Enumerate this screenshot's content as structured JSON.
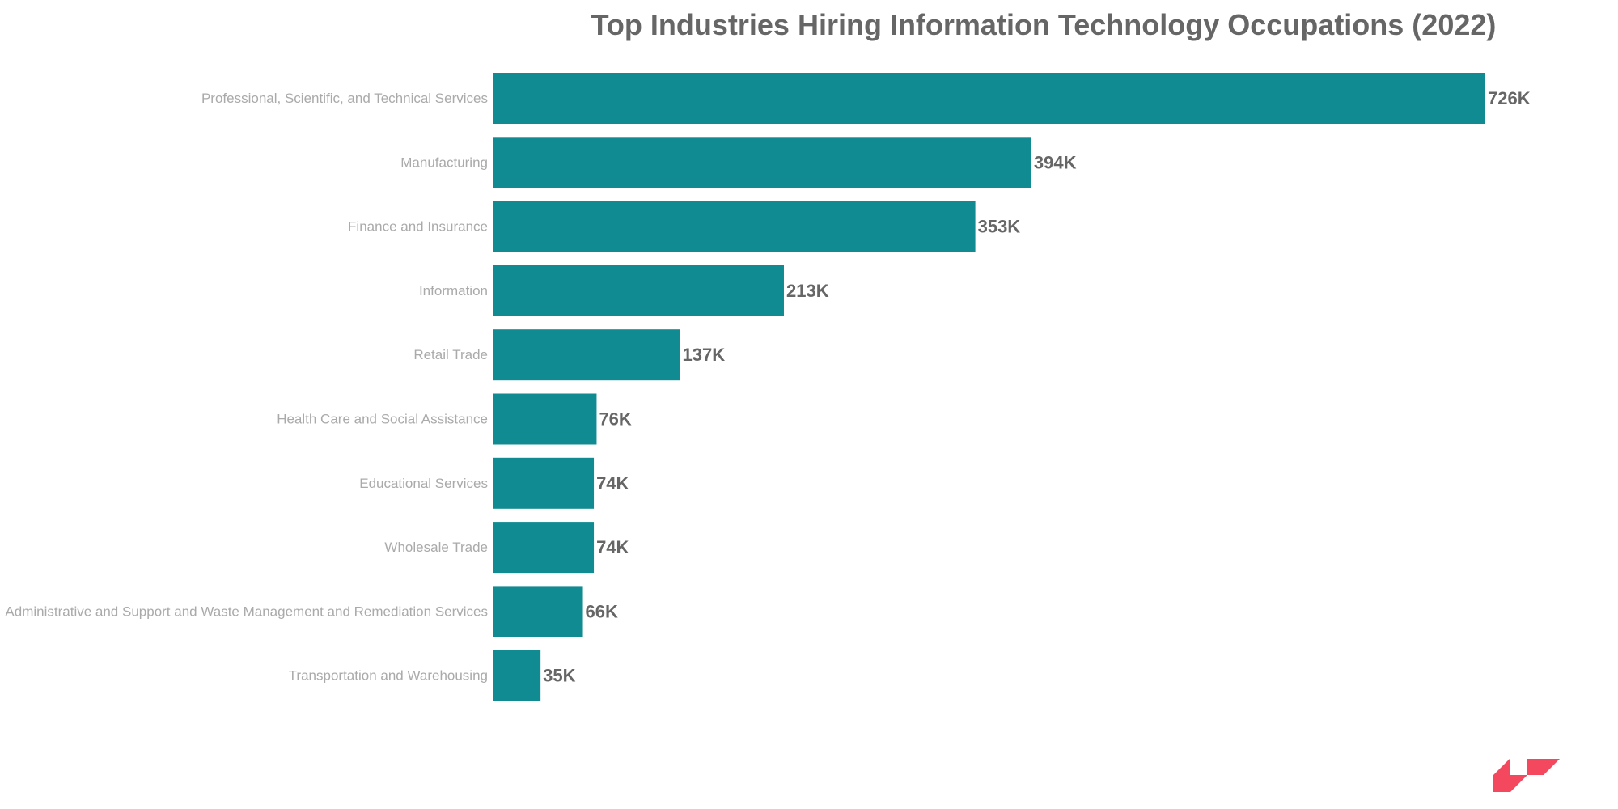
{
  "chart_data": {
    "type": "bar",
    "orientation": "horizontal",
    "title": "Top Industries Hiring Information Technology Occupations (2022)",
    "xlabel": "",
    "ylabel": "",
    "grid": false,
    "legend": "none",
    "value_unit": "thousands",
    "categories": [
      "Professional, Scientific, and Technical Services",
      "Manufacturing",
      "Finance and Insurance",
      "Information",
      "Retail Trade",
      "Health Care and Social Assistance",
      "Educational Services",
      "Wholesale Trade",
      "Administrative and Support and Waste Management and Remediation Services",
      "Transportation and Warehousing"
    ],
    "values": [
      726,
      394,
      353,
      213,
      137,
      76,
      74,
      74,
      66,
      35
    ],
    "data_labels": [
      "726K",
      "394K",
      "353K",
      "213K",
      "137K",
      "76K",
      "74K",
      "74K",
      "66K",
      "35K"
    ],
    "xlim": [
      0,
      726
    ]
  },
  "colors": {
    "bar": "#108b91",
    "logo": "#f4485f",
    "title": "#666666",
    "category_label": "#aaaaaa",
    "value_label": "#666666"
  },
  "logo": {
    "icon": "brand-logo-icon"
  }
}
